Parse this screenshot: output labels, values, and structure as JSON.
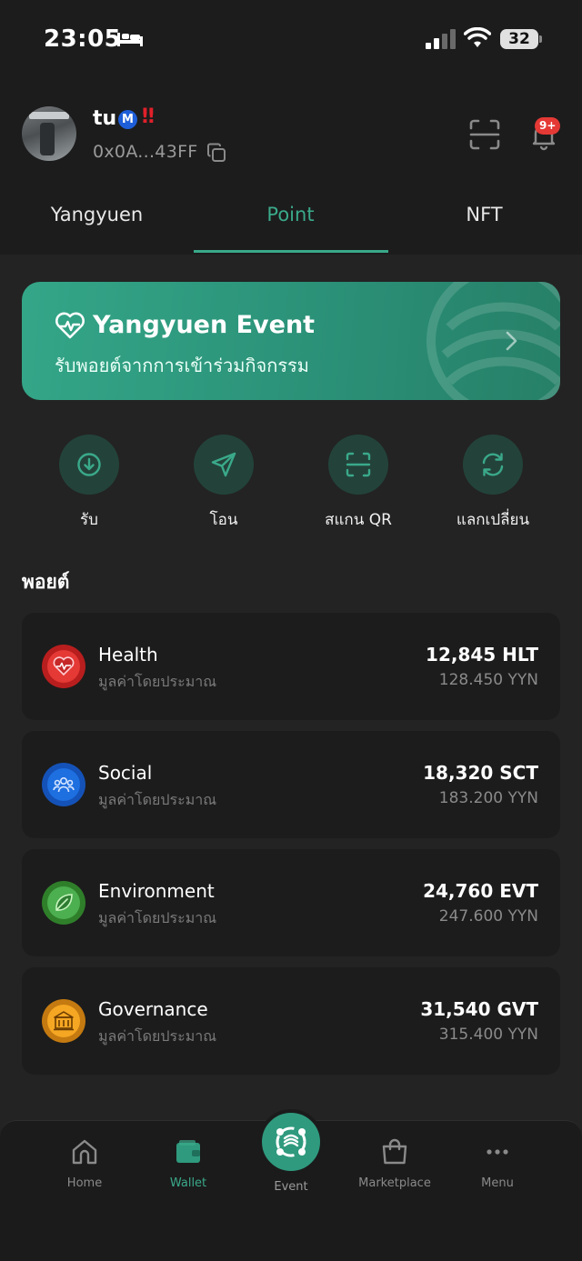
{
  "status_bar": {
    "time": "23:05",
    "battery": "32"
  },
  "profile": {
    "username": "tu",
    "verified_badge": "M",
    "alert_badge": "‼",
    "address": "0x0A...43FF",
    "notification_count": "9+"
  },
  "tabs": [
    {
      "label": "Yangyuen",
      "active": false
    },
    {
      "label": "Point",
      "active": true
    },
    {
      "label": "NFT",
      "active": false
    }
  ],
  "banner": {
    "title": "Yangyuen Event",
    "subtitle": "รับพอยต์จากการเข้าร่วมกิจกรรม"
  },
  "quick_actions": [
    {
      "label": "รับ",
      "icon": "receive-icon"
    },
    {
      "label": "โอน",
      "icon": "send-icon"
    },
    {
      "label": "สแกน QR",
      "icon": "scan-qr-icon"
    },
    {
      "label": "แลกเปลี่ยน",
      "icon": "exchange-icon"
    }
  ],
  "points_section": {
    "title": "พอยต์"
  },
  "points": [
    {
      "name": "Health",
      "subtitle": "มูลค่าโดยประมาณ",
      "amount": "12,845 HLT",
      "value": "128.450 YYN",
      "color": "#e53935",
      "icon": "heart-pulse-icon"
    },
    {
      "name": "Social",
      "subtitle": "มูลค่าโดยประมาณ",
      "amount": "18,320 SCT",
      "value": "183.200 YYN",
      "color": "#1e6fe0",
      "icon": "people-icon"
    },
    {
      "name": "Environment",
      "subtitle": "มูลค่าโดยประมาณ",
      "amount": "24,760 EVT",
      "value": "247.600 YYN",
      "color": "#43a83c",
      "icon": "leaf-icon"
    },
    {
      "name": "Governance",
      "subtitle": "มูลค่าโดยประมาณ",
      "amount": "31,540 GVT",
      "value": "315.400 YYN",
      "color": "#f0a020",
      "icon": "building-icon"
    }
  ],
  "bottom_nav": {
    "home": "Home",
    "wallet": "Wallet",
    "event": "Event",
    "marketplace": "Marketplace",
    "menu": "Menu"
  },
  "colors": {
    "accent": "#3aa98a",
    "background": "#232323",
    "card": "#1c1c1c"
  }
}
